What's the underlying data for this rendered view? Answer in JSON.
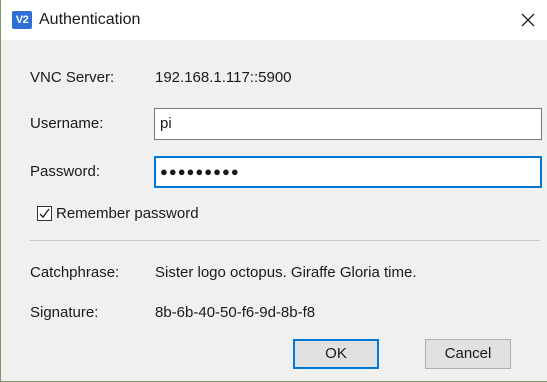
{
  "window": {
    "title": "Authentication",
    "app_icon_text": "V2",
    "accent_color": "#0078d7"
  },
  "fields": {
    "vnc_server_label": "VNC Server:",
    "vnc_server_value": "192.168.1.117::5900",
    "username_label": "Username:",
    "username_value": "pi",
    "password_label": "Password:",
    "password_value": "●●●●●●●●●"
  },
  "options": {
    "remember_label": "Remember password",
    "remember_checked": true
  },
  "info": {
    "catchphrase_label": "Catchphrase:",
    "catchphrase_value": "Sister logo octopus. Giraffe Gloria time.",
    "signature_label": "Signature:",
    "signature_value": "8b-6b-40-50-f6-9d-8b-f8"
  },
  "buttons": {
    "ok_label": "OK",
    "cancel_label": "Cancel"
  }
}
